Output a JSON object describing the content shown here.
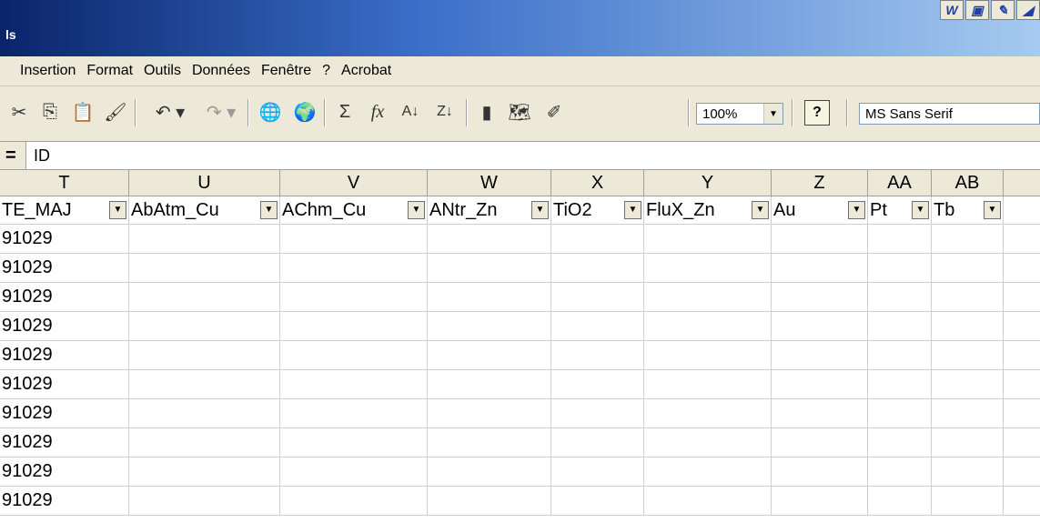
{
  "window": {
    "title": "ls",
    "title_icons": [
      "word-icon",
      "window-icon",
      "pencil-icon",
      "misc-icon"
    ]
  },
  "menu": [
    "Insertion",
    "Format",
    "Outils",
    "Données",
    "Fenêtre",
    "?",
    "Acrobat"
  ],
  "toolbar": {
    "zoom": "100%",
    "font": "MS Sans Serif",
    "help": "?"
  },
  "formula": {
    "equals": "=",
    "value": "ID"
  },
  "columns": [
    "T",
    "U",
    "V",
    "W",
    "X",
    "Y",
    "Z",
    "AA",
    "AB"
  ],
  "fields": [
    "TE_MAJ",
    "AbAtm_Cu",
    "AChm_Cu",
    "ANtr_Zn",
    "TiO2",
    "FluX_Zn",
    "Au",
    "Pt",
    "Tb"
  ],
  "rows": [
    [
      "91029"
    ],
    [
      "91029"
    ],
    [
      "91029"
    ],
    [
      "91029"
    ],
    [
      "91029"
    ],
    [
      "91029"
    ],
    [
      "91029"
    ],
    [
      "91029"
    ],
    [
      "91029"
    ],
    [
      "91029"
    ]
  ],
  "colors": {
    "title_gradient_start": "#0a246a",
    "title_gradient_end": "#a6caf0",
    "chrome": "#ece9d8"
  }
}
